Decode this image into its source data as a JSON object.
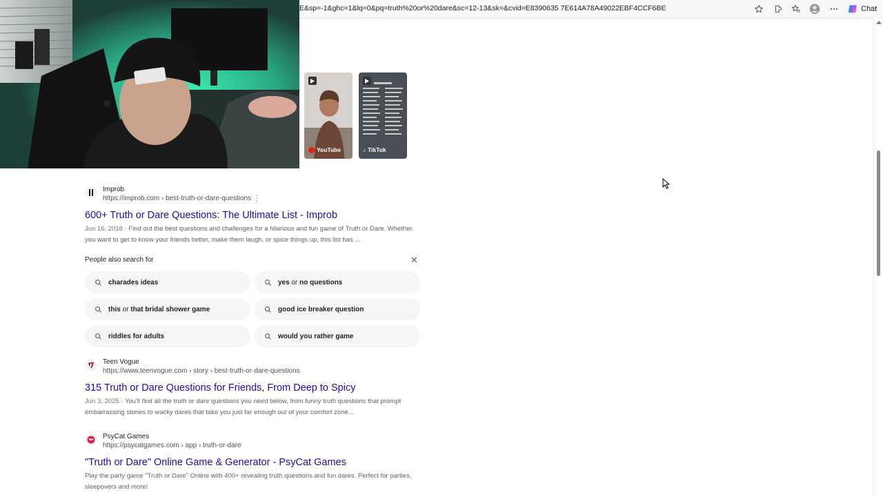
{
  "browser": {
    "url": "E&sp=-1&ghc=1&lq=0&pq=truth%20or%20dare&sc=12-13&sk=&cvid=E8390635 7E614A78A49022EBF4CCF6BE",
    "chat_label": "Chat",
    "icons": [
      "favorite-star-icon",
      "extensions-icon",
      "favorites-icon",
      "profile-icon",
      "more-icon",
      "copilot-icon"
    ]
  },
  "videos": [
    {
      "source": "YouTube"
    },
    {
      "source": "TikTok"
    }
  ],
  "results": [
    {
      "site": "Improb",
      "url": "https://improb.com › best-truth-or-dare-questions",
      "title": "600+ Truth or Dare Questions: The Ultimate List - Improb",
      "date": "Jun 16, 2018",
      "snippet": "Find out the best questions and challenges for a hilarious and fun game of Truth or Dare. Whether you want to get to know your friends better, make them laugh, or spice things up, this list has ..."
    },
    {
      "site": "Teen Vogue",
      "url": "https://www.teenvogue.com › story › best-truth-or-dare-questions",
      "title": "315 Truth or Dare Questions for Friends, From Deep to Spicy",
      "date": "Jun 3, 2025",
      "snippet": "You'll find all the truth or dare questions you need below, from funny truth questions that prompt embarrassing stories to wacky dares that take you just far enough out of your comfort zone..."
    },
    {
      "site": "PsyCat Games",
      "url": "https://psycatgames.com › app › truth-or-dare",
      "title": "\"Truth or Dare\" Online Game & Generator - PsyCat Games",
      "date": "",
      "snippet": "Play the party game \"Truth or Dare\" Online with 400+ revealing truth questions and fun dares. Perfect for parties, sleepovers and more!"
    }
  ],
  "people_also_search": {
    "heading": "People also search for",
    "close_symbol": "✕",
    "chips": [
      {
        "pre": "charades ideas",
        "mid": "",
        "post": ""
      },
      {
        "pre": "yes",
        "mid": " or ",
        "post": "no questions"
      },
      {
        "pre": "this",
        "mid": " or ",
        "post": "that bridal shower game"
      },
      {
        "pre": "good ice breaker question",
        "mid": "",
        "post": ""
      },
      {
        "pre": "riddles for adults",
        "mid": "",
        "post": ""
      },
      {
        "pre": "would you rather game",
        "mid": "",
        "post": ""
      }
    ]
  },
  "colors": {
    "link": "#1a0dab",
    "chip_bg": "#f6f6f6",
    "webcam_glow": "#2fe0a6"
  }
}
